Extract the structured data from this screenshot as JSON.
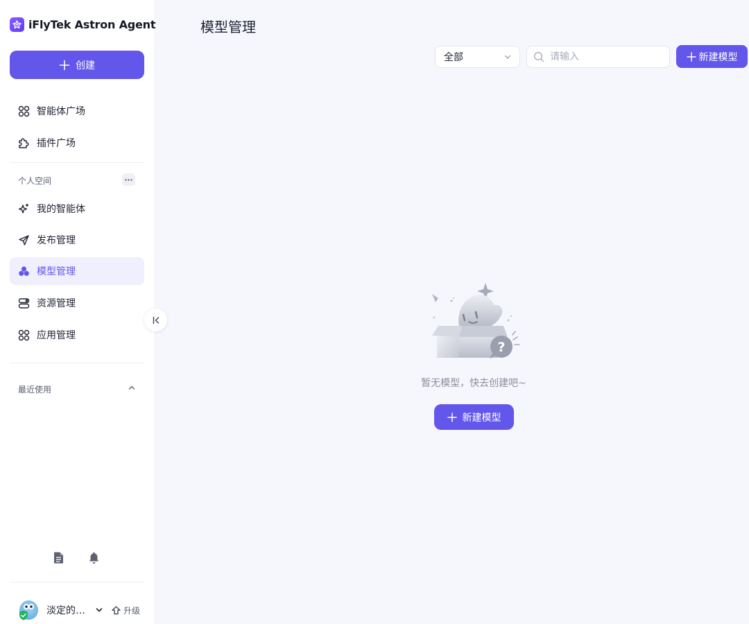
{
  "brand": {
    "name": "iFlyTek Astron Agent"
  },
  "sidebar": {
    "create_label": "创建",
    "nav_top": [
      {
        "label": "智能体广场",
        "icon": "grid-icon"
      },
      {
        "label": "插件广场",
        "icon": "puzzle-icon"
      }
    ],
    "personal_space_label": "个人空间",
    "nav_personal": [
      {
        "label": "我的智能体",
        "icon": "sparkle-icon"
      },
      {
        "label": "发布管理",
        "icon": "send-icon"
      },
      {
        "label": "模型管理",
        "icon": "model-icon",
        "active": true
      },
      {
        "label": "资源管理",
        "icon": "resource-icon"
      },
      {
        "label": "应用管理",
        "icon": "grid-icon"
      }
    ],
    "recent_label": "最近使用",
    "footer_icons": [
      "document-icon",
      "bell-icon"
    ],
    "user": {
      "name": "淡定的…",
      "upgrade_label": "升级"
    }
  },
  "main": {
    "title": "模型管理",
    "filter": {
      "selected": "全部"
    },
    "search": {
      "placeholder": "请输入"
    },
    "new_model_label": "新建模型",
    "empty": {
      "message": "暂无模型，快去创建吧~",
      "button_label": "新建模型"
    }
  },
  "colors": {
    "accent": "#6356ea",
    "active_bg": "#f0effd",
    "page_bg": "#f6f7fc"
  }
}
